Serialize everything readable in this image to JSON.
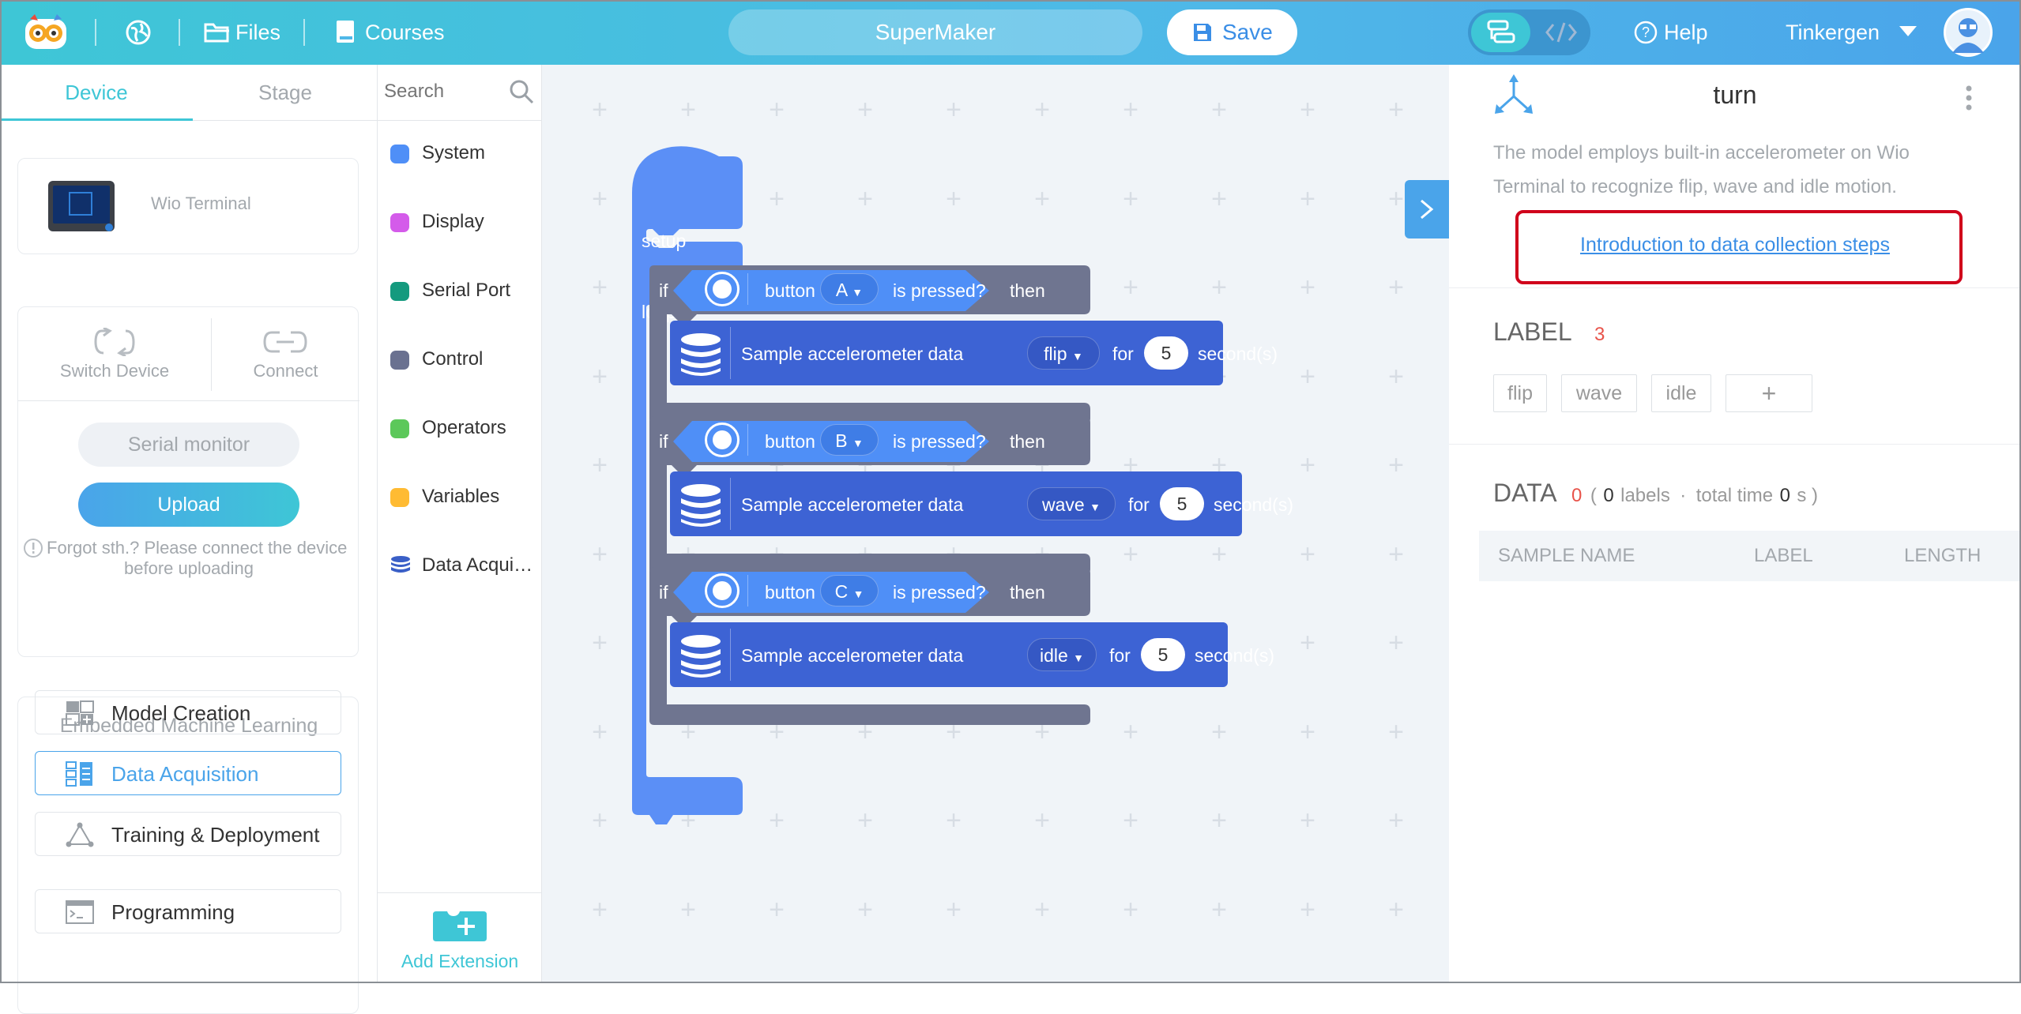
{
  "topbar": {
    "files_label": "Files",
    "courses_label": "Courses",
    "project_name": "SuperMaker",
    "save_label": "Save",
    "help_label": "Help",
    "user_name": "Tinkergen"
  },
  "left": {
    "tabs": [
      {
        "label": "Device",
        "active": true
      },
      {
        "label": "Stage",
        "active": false
      }
    ],
    "device_name": "Wio Terminal",
    "switch_device_label": "Switch Device",
    "connect_label": "Connect",
    "serial_monitor_label": "Serial monitor",
    "upload_label": "Upload",
    "upload_hint_line1": "Forgot sth.? Please connect the device",
    "upload_hint_line2": "before uploading",
    "eml_title": "Embedded Machine Learning",
    "eml_items": [
      {
        "label": "Model Creation"
      },
      {
        "label": "Data Acquisition",
        "active": true
      },
      {
        "label": "Training & Deployment"
      }
    ],
    "programming_label": "Programming"
  },
  "palette": {
    "search_placeholder": "Search",
    "categories": [
      {
        "name": "System",
        "color": "#4f8ff7"
      },
      {
        "name": "Display",
        "color": "#d45bea"
      },
      {
        "name": "Serial Port",
        "color": "#149a7e"
      },
      {
        "name": "Control",
        "color": "#6a7190"
      },
      {
        "name": "Operators",
        "color": "#5cc85a"
      },
      {
        "name": "Variables",
        "color": "#ffbb33"
      },
      {
        "name": "Data Acqui…",
        "color": "#3a5fc7"
      }
    ],
    "add_extension_label": "Add Extension"
  },
  "blocks": {
    "setup_label": "setup",
    "loop_label": "loop",
    "if_label": "if",
    "button_label": "button",
    "is_pressed_label": "is pressed?",
    "then_label": "then",
    "sample_label": "Sample accelerometer data",
    "for_label": "for",
    "seconds_label": "second(s)",
    "rows": [
      {
        "button": "A",
        "label": "flip",
        "seconds": "5"
      },
      {
        "button": "B",
        "label": "wave",
        "seconds": "5"
      },
      {
        "button": "C",
        "label": "idle",
        "seconds": "5"
      }
    ]
  },
  "right": {
    "model_name": "turn",
    "description_line1": "The model employs built-in accelerometer on Wio",
    "description_line2": "Terminal to recognize flip, wave and idle motion.",
    "intro_link": "Introduction to data collection steps",
    "label_title": "LABEL",
    "label_count": "3",
    "labels": [
      "flip",
      "wave",
      "idle"
    ],
    "add_label": "+",
    "data_title": "DATA",
    "data_count": "0",
    "data_open": "(",
    "data_labels_count": "0",
    "data_labels_word": "labels",
    "data_dot": "·",
    "data_total_time_word": "total time",
    "data_total_time": "0",
    "data_unit_close": "s )",
    "table_headers": [
      "SAMPLE NAME",
      "LABEL",
      "LENGTH"
    ]
  },
  "colors": {
    "accent": "#4aa4ea",
    "teal": "#3ec6d6",
    "highlight_box": "#d0021b",
    "label_count": "#e8534a"
  }
}
